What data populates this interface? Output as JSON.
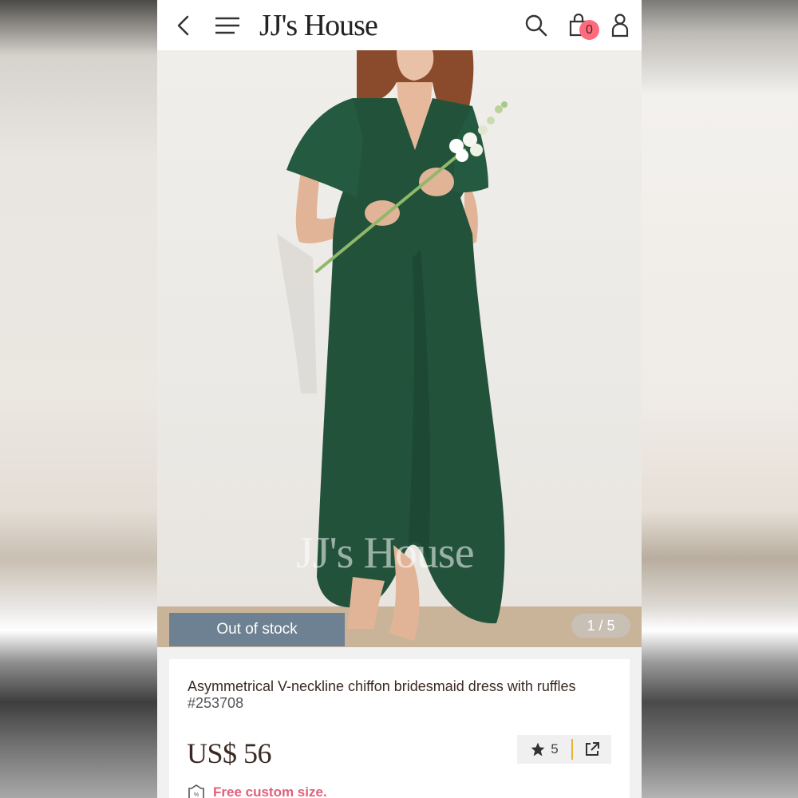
{
  "header": {
    "logo": "JJ's House",
    "cart_count": "0"
  },
  "hero": {
    "watermark": "JJ's House",
    "stock_label": "Out of stock",
    "image_counter": "1 / 5",
    "dress_color": "#22523a"
  },
  "product": {
    "title": "Asymmetrical V-neckline chiffon bridesmaid dress with ruffles",
    "sku": "#253708",
    "price": "US$ 56",
    "rating_count": "5",
    "promo": "Free custom size."
  },
  "colors": {
    "accent_pink": "#ff6b7d",
    "promo_pink": "#e0607a",
    "stock_badge": "#6d8192",
    "divider_gold": "#e7b13a"
  },
  "icons": [
    "back-icon",
    "menu-icon",
    "search-icon",
    "bag-icon",
    "user-icon",
    "star-icon",
    "share-icon",
    "discount-tag-icon"
  ]
}
